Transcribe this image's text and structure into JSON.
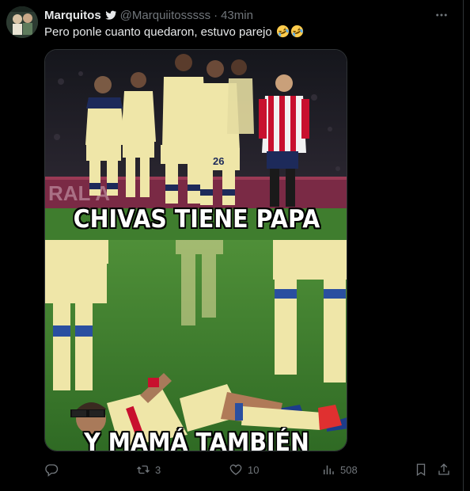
{
  "author": {
    "name": "Marquitos",
    "handle": "@Marquiitosssss",
    "separator": "·",
    "time": "43min"
  },
  "tweet": {
    "text": "Pero ponle cuanto quedaron, estuvo parejo",
    "emojis": [
      "rolling-on-floor-laughing",
      "rolling-on-floor-laughing"
    ]
  },
  "meme": {
    "top_caption": "CHIVAS TIENE PAPA",
    "bottom_caption": "Y MAMÁ TAMBIÉN",
    "colors": {
      "america_yellow": "#efe6a8",
      "america_navy": "#1d2a5a",
      "chivas_red": "#c8102e",
      "pitch_green": "#3f7d2e"
    }
  },
  "actions": {
    "reply": {
      "icon": "reply-icon",
      "count": ""
    },
    "retweet": {
      "icon": "retweet-icon",
      "count": "3"
    },
    "like": {
      "icon": "heart-icon",
      "count": "10"
    },
    "views": {
      "icon": "views-icon",
      "count": "508"
    },
    "bookmark": {
      "icon": "bookmark-icon"
    },
    "share": {
      "icon": "share-icon"
    }
  },
  "colors": {
    "background": "#000000",
    "text": "#e7e9ea",
    "muted": "#71767b",
    "border": "#2f3336"
  }
}
